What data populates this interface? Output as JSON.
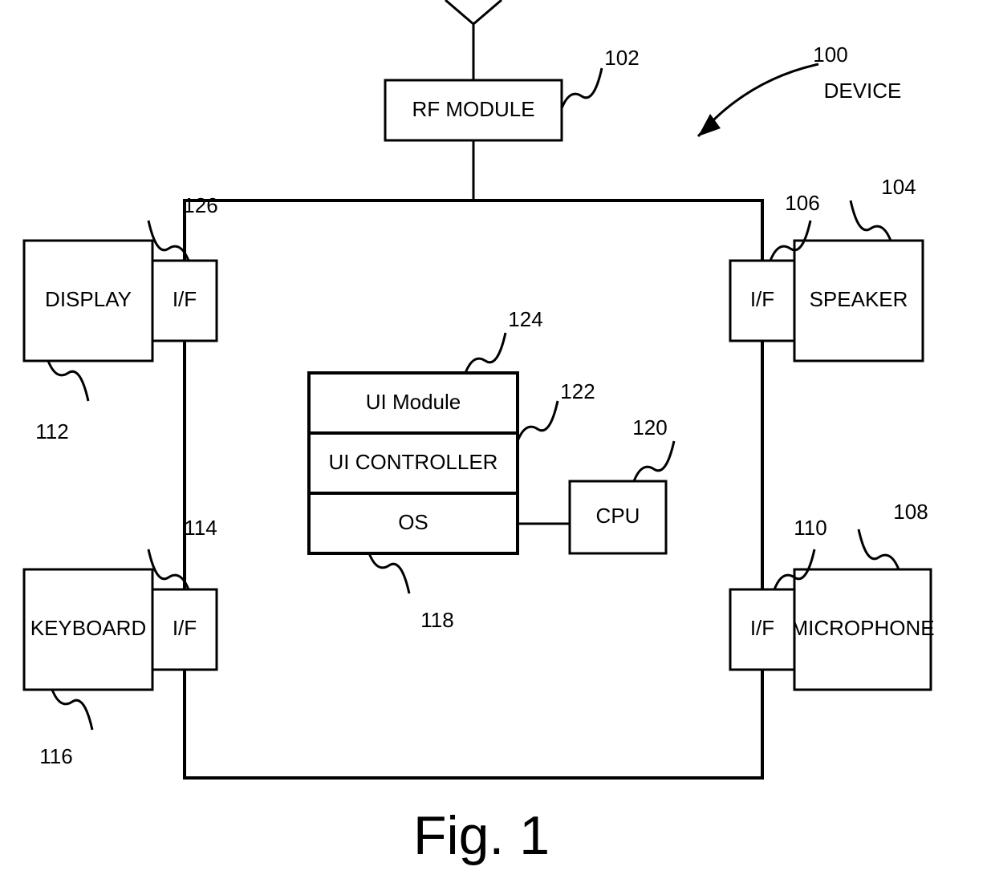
{
  "figure_label": "Fig. 1",
  "overall": {
    "ref": "100",
    "label": "DEVICE"
  },
  "blocks": {
    "rf": {
      "ref": "102",
      "label": "RF MODULE"
    },
    "speaker": {
      "ref": "104",
      "label": "SPEAKER"
    },
    "if_spk": {
      "ref": "106",
      "label": "I/F"
    },
    "microphone": {
      "ref": "108",
      "label": "MICROPHONE"
    },
    "if_mic": {
      "ref": "110",
      "label": "I/F"
    },
    "display": {
      "ref": "112",
      "label": "DISPLAY"
    },
    "if_kbd": {
      "ref": "114",
      "label": "I/F"
    },
    "keyboard": {
      "ref": "116",
      "label": "KEYBOARD"
    },
    "os": {
      "ref": "118",
      "label": "OS"
    },
    "cpu": {
      "ref": "120",
      "label": "CPU"
    },
    "ui_ctrl": {
      "ref": "122",
      "label": "UI CONTROLLER"
    },
    "ui_mod": {
      "ref": "124",
      "label": "UI Module"
    },
    "if_disp": {
      "ref": "126",
      "label": "I/F"
    }
  }
}
